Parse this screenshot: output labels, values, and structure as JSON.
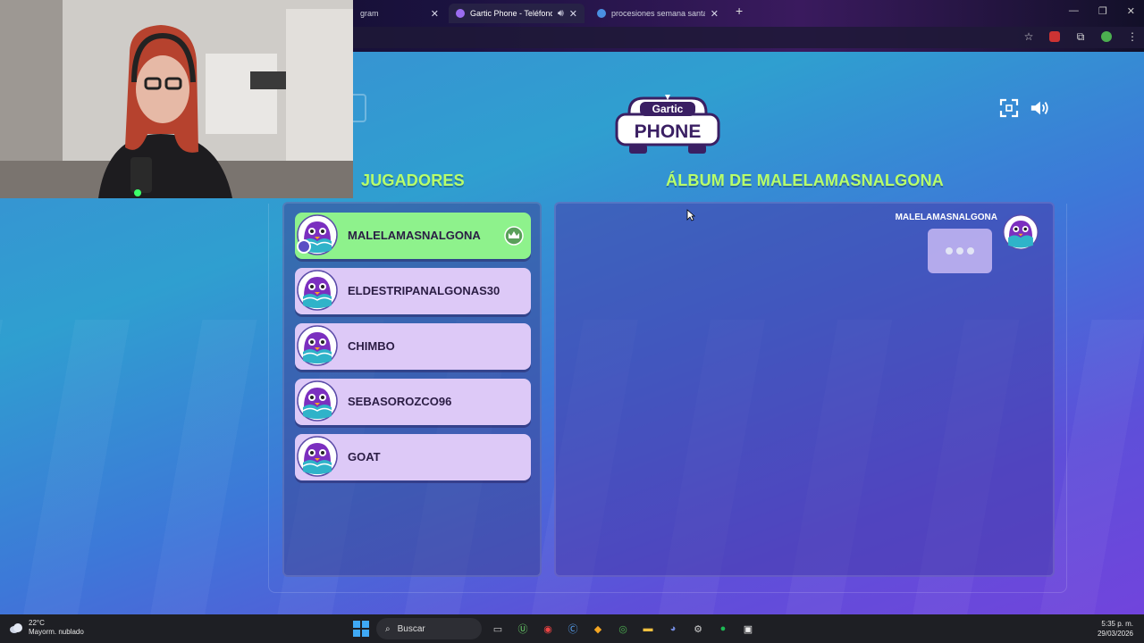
{
  "browser": {
    "tabs": [
      {
        "title": "gram",
        "icon_color": "#8a8a8a"
      },
      {
        "title": "Gartic Phone - Teléfono De",
        "icon_color": "#9b6cf0",
        "active": true
      },
      {
        "title": "procesiones semana santa colo",
        "icon_color": "#4a90e2"
      }
    ],
    "new_tab": "+",
    "controls": [
      "—",
      "❐",
      "✕"
    ]
  },
  "game": {
    "logo_top": "Gartic",
    "logo_bottom": "PHONE",
    "players_heading": "JUGADORES",
    "album_heading": "ÁLBUM DE MALELAMASNALGONA",
    "players": [
      {
        "name": "MALELAMASNALGONA",
        "host": true
      },
      {
        "name": "ELDESTRIPANALGONAS30"
      },
      {
        "name": "CHIMBO"
      },
      {
        "name": "SEBASOROZCO96"
      },
      {
        "name": "GOAT"
      }
    ],
    "album": {
      "user": "MALELAMASNALGONA",
      "status": "typing"
    },
    "colors": {
      "accent_green": "#b8ff6a",
      "host_row": "#8ef28c",
      "player_row": "#ddc9f7"
    }
  },
  "taskbar": {
    "weather_temp": "22°C",
    "weather_desc": "Mayorm. nublado",
    "search_placeholder": "Buscar",
    "time": "5:35 p. m.",
    "date": "29/03/2026"
  }
}
